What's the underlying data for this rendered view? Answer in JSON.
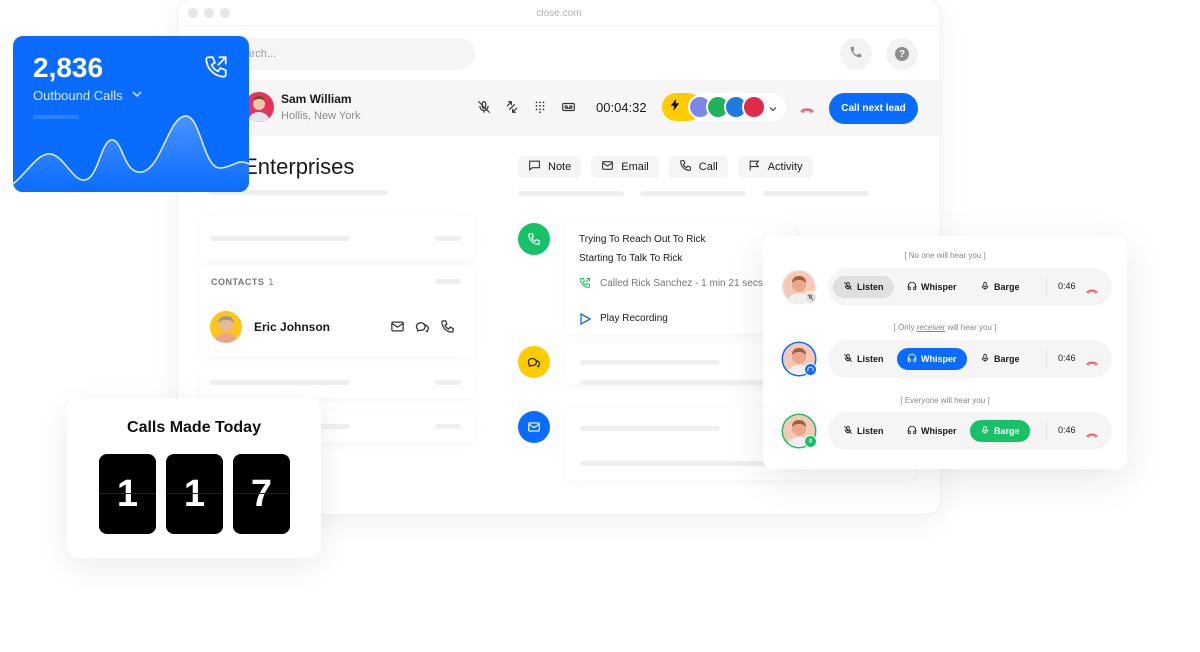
{
  "window": {
    "url": "close.com",
    "search_placeholder": "Search..."
  },
  "active_call": {
    "caller_name": "Sam William",
    "caller_location": "Hollis, New York",
    "timer": "00:04:32",
    "controls": [
      "mute-icon",
      "transfer-icon",
      "keypad-icon",
      "voicemail-icon"
    ],
    "call_next_label": "Call next lead",
    "team_avatar_colors": [
      "#7b86e8",
      "#1fb35c",
      "#1f7ae0",
      "#e02a4a"
    ]
  },
  "lead": {
    "company_title": "Rick Enterprises",
    "company_title_visible": "k Enterprises",
    "actions": [
      {
        "label": "Note",
        "icon": "note-icon"
      },
      {
        "label": "Email",
        "icon": "email-icon"
      },
      {
        "label": "Call",
        "icon": "phone-icon"
      },
      {
        "label": "Activity",
        "icon": "flag-icon"
      }
    ],
    "contacts_label": "CONTACTS",
    "contacts_count": "1",
    "contacts": [
      {
        "name": "Eric Johnson"
      }
    ]
  },
  "timeline": {
    "call_entry": {
      "line1": "Trying To Reach Out To Rick",
      "line2": "Starting To Talk To Rick",
      "call_summary": "Called Rick Sanchez - 1 min 21 secs",
      "play_label": "Play Recording"
    }
  },
  "outbound_card": {
    "value": "2,836",
    "label": "Outbound Calls"
  },
  "calls_today": {
    "title": "Calls Made Today",
    "digits": [
      "1",
      "1",
      "7"
    ]
  },
  "monitor": {
    "rows": [
      {
        "note": "[ No one will hear you ]",
        "active": "Listen",
        "time": "0:46"
      },
      {
        "note_prefix": "[ Only ",
        "note_emphasis": "receiver",
        "note_suffix": " will hear you ]",
        "active": "Whisper",
        "time": "0:46"
      },
      {
        "note": "[ Everyone will hear you ]",
        "active": "Barge",
        "time": "0:46"
      }
    ],
    "labels": {
      "listen": "Listen",
      "whisper": "Whisper",
      "barge": "Barge"
    }
  },
  "colors": {
    "brand_blue": "#0a6cff",
    "green": "#17c167",
    "yellow": "#ffcc00",
    "hangup_red": "#e85c7a"
  }
}
